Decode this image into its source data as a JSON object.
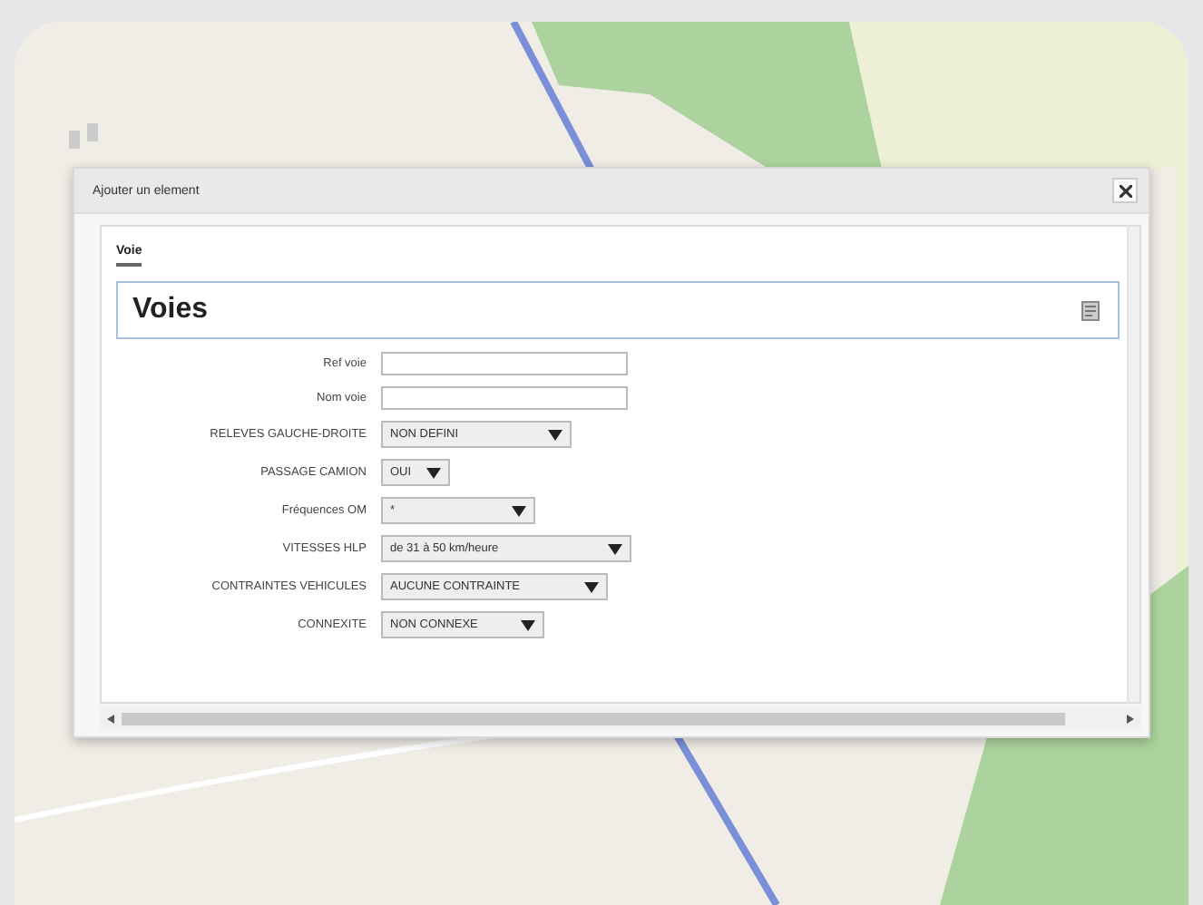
{
  "dialog": {
    "title": "Ajouter un element"
  },
  "tabs": [
    {
      "label": "Voie",
      "selected": true
    }
  ],
  "section": {
    "title": "Voies"
  },
  "fields": [
    {
      "label": "Ref voie",
      "kind": "text"
    },
    {
      "label": "Nom voie",
      "kind": "text"
    },
    {
      "label": "RELEVES GAUCHE-DROITE",
      "kind": "select",
      "value": "NON DEFINI"
    },
    {
      "label": "PASSAGE CAMION",
      "kind": "select",
      "value": "OUI"
    },
    {
      "label": "Fréquences OM",
      "kind": "select",
      "value": "*"
    },
    {
      "label": "VITESSES HLP",
      "kind": "select",
      "value": "de 31 à 50 km/heure"
    },
    {
      "label": "CONTRAINTES VEHICULES",
      "kind": "select",
      "value": "AUCUNE CONTRAINTE"
    },
    {
      "label": "CONNEXITE",
      "kind": "select",
      "value": "NON CONNEXE"
    }
  ]
}
